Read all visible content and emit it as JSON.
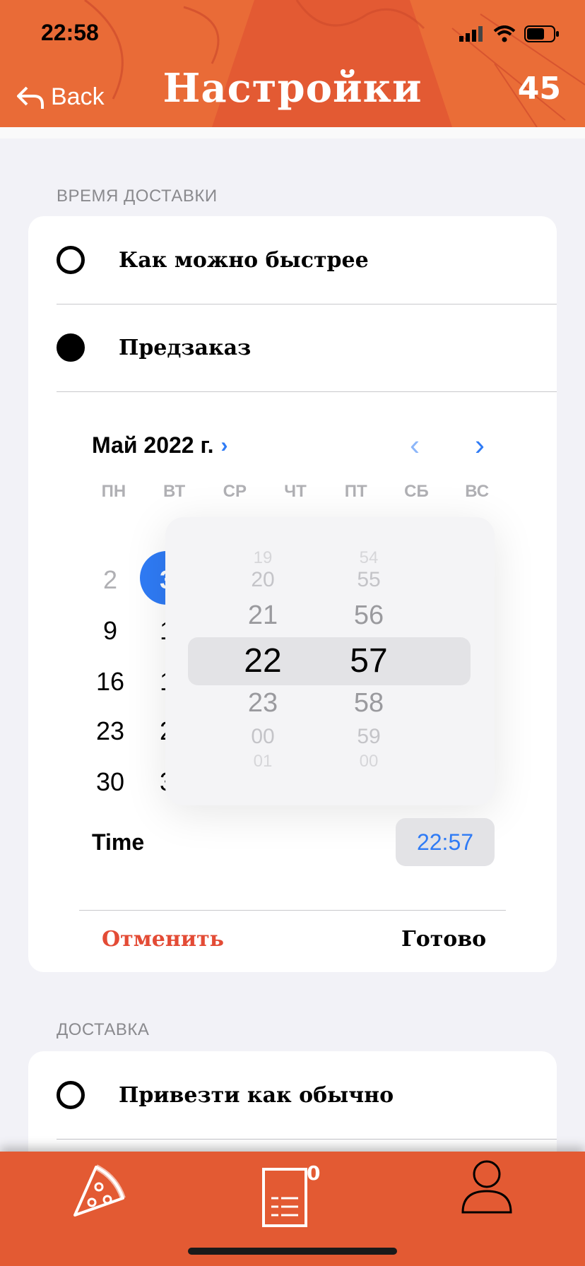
{
  "status": {
    "time": "22:58"
  },
  "header": {
    "back_label": "Back",
    "title": "Настройки",
    "count": "45",
    "accent": "#e35a33"
  },
  "delivery_time": {
    "section_label": "ВРЕМЯ ДОСТАВКИ",
    "options": [
      {
        "label": "Как можно быстрее",
        "selected": false
      },
      {
        "label": "Предзаказ",
        "selected": true
      }
    ]
  },
  "calendar": {
    "month_label": "Май 2022 г.",
    "weekdays": [
      "ПН",
      "ВТ",
      "СР",
      "ЧТ",
      "ПТ",
      "СБ",
      "ВС"
    ],
    "rows": [
      [
        "2",
        "3"
      ],
      [
        "9",
        "1"
      ],
      [
        "16",
        "1"
      ],
      [
        "23",
        "2"
      ],
      [
        "30",
        "3"
      ]
    ],
    "selected_day": "3"
  },
  "time_picker": {
    "hours": [
      "19",
      "20",
      "21",
      "22",
      "23",
      "00",
      "01"
    ],
    "minutes": [
      "54",
      "55",
      "56",
      "57",
      "58",
      "59",
      "00"
    ],
    "selected_hour": "22",
    "selected_minute": "57"
  },
  "time_row": {
    "label": "Time",
    "value": "22:57"
  },
  "actions": {
    "cancel_label": "Отменить",
    "done_label": "Готово"
  },
  "delivery": {
    "section_label": "ДОСТАВКА",
    "options": [
      {
        "label": "Привезти как обычно",
        "selected": false
      }
    ]
  },
  "tabbar": {
    "cart_badge": "0"
  }
}
